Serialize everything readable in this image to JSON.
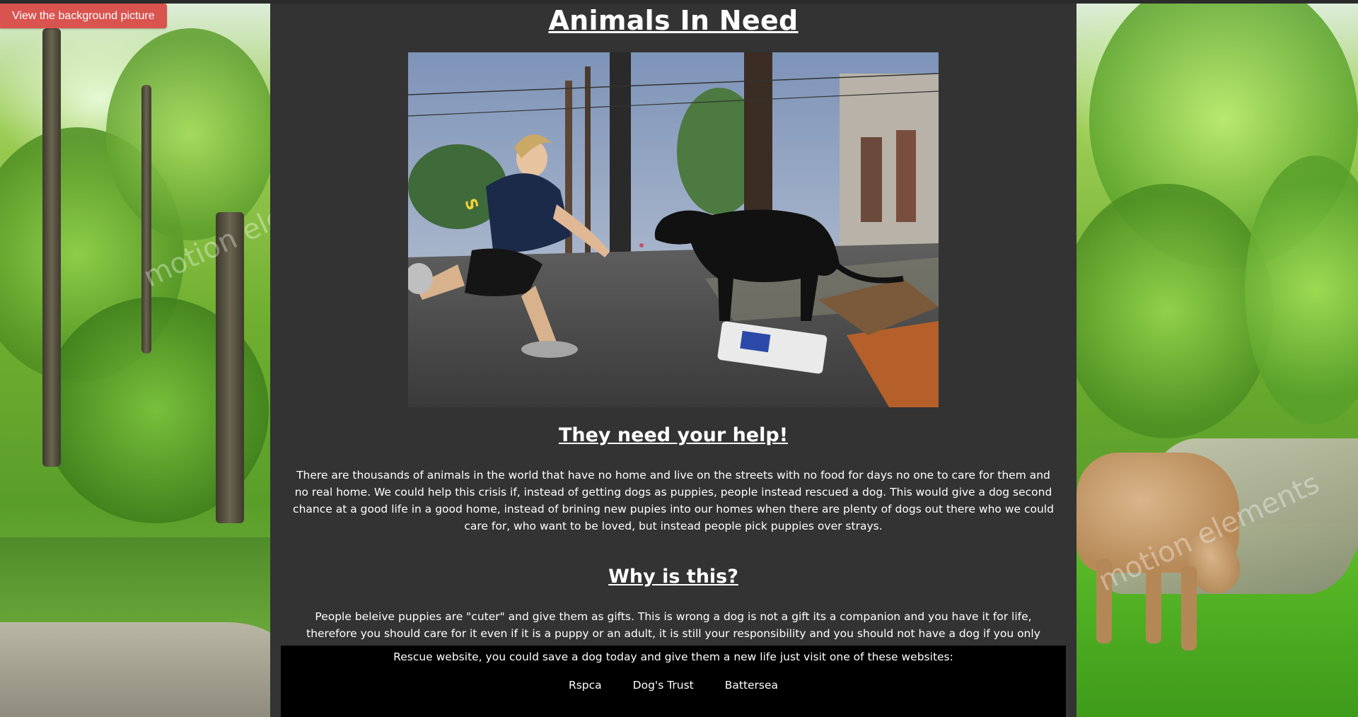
{
  "background_button": {
    "label": "View the background picture"
  },
  "page": {
    "title": "Animals In Need",
    "hero_image": {
      "alt": "Rescuer crouching to feed a stray black dog on a city street"
    },
    "sections": [
      {
        "heading": "They need your help!",
        "text": "There are thousands of animals in the world that have no home and live on the streets with no food for days no one to care for them and no real home. We could help this crisis if, instead of getting dogs as puppies, people instead rescued a dog. This would give a dog second chance at a good life in a good home, instead of brining new pupies into our homes when there are plenty of dogs out there who we could care for, who want to be loved, but instead people pick puppies over strays."
      },
      {
        "heading": "Why is this?",
        "text": "People beleive puppies are \"cuter\" and give them as gifts. This is wrong a dog is not a gift its a companion and you have it for life, therefore you should care for it even if it is a puppy or an adult, it is still your responsibility and you should not have a dog if you only want a puppy."
      }
    ],
    "rescue": {
      "text": "Rescue website, you could save a dog today and give them a new life just visit one of these websites:",
      "links": [
        "Rspca",
        "Dog's Trust",
        "Battersea"
      ]
    }
  },
  "colors": {
    "content_bg": "#333333",
    "rescue_bg": "#000000",
    "button_bg": "#d9534f",
    "text": "#ffffff"
  },
  "watermarks": [
    "motion elements",
    "motion elements"
  ]
}
